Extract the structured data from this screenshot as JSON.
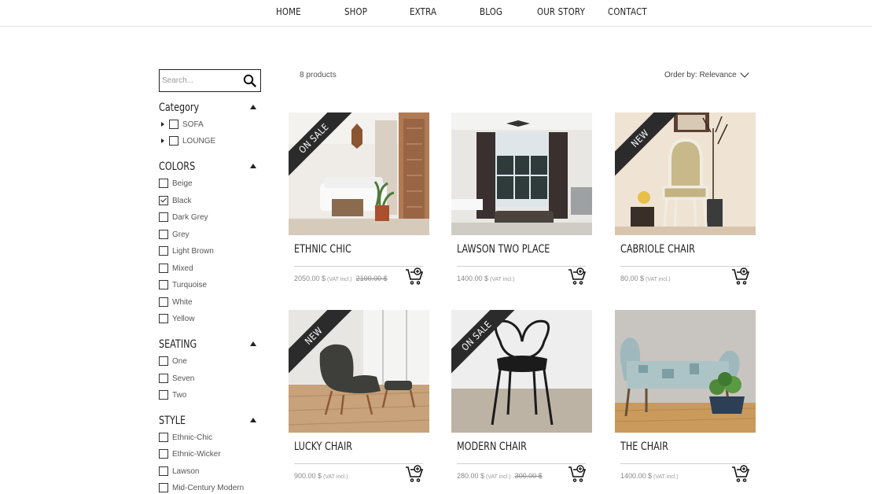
{
  "nav": {
    "items": [
      {
        "label": "HOME"
      },
      {
        "label": "SHOP"
      },
      {
        "label": "EXTRA"
      },
      {
        "label": "BLOG"
      },
      {
        "label": "OUR STORY"
      },
      {
        "label": "CONTACT"
      }
    ]
  },
  "search": {
    "placeholder": "Search...",
    "value": "",
    "icon": "search-icon"
  },
  "filters": {
    "category": {
      "title": "Category",
      "options": [
        {
          "label": "SOFA",
          "checked": false,
          "expandable": true
        },
        {
          "label": "LOUNGE",
          "checked": false,
          "expandable": true
        }
      ]
    },
    "colors": {
      "title": "COLORS",
      "options": [
        {
          "label": "Beige",
          "checked": false
        },
        {
          "label": "Black",
          "checked": true
        },
        {
          "label": "Dark Grey",
          "checked": false
        },
        {
          "label": "Grey",
          "checked": false
        },
        {
          "label": "Light Brown",
          "checked": false
        },
        {
          "label": "Mixed",
          "checked": false
        },
        {
          "label": "Turquoise",
          "checked": false
        },
        {
          "label": "White",
          "checked": false
        },
        {
          "label": "Yellow",
          "checked": false
        }
      ]
    },
    "seating": {
      "title": "SEATING",
      "options": [
        {
          "label": "One",
          "checked": false
        },
        {
          "label": "Seven",
          "checked": false
        },
        {
          "label": "Two",
          "checked": false
        }
      ]
    },
    "style": {
      "title": "STYLE",
      "options": [
        {
          "label": "Ethnic-Chic",
          "checked": false
        },
        {
          "label": "Ethnic-Wicker",
          "checked": false
        },
        {
          "label": "Lawson",
          "checked": false
        },
        {
          "label": "Mid-Century Modern",
          "checked": false
        }
      ]
    }
  },
  "listing": {
    "count": "8 products",
    "order_label": "Order by: Relevance"
  },
  "products": [
    {
      "name": "ETHNIC CHIC",
      "price": "2050.00 $",
      "vat": "(VAT incl.)",
      "old_price": "2100.00 $",
      "badge": "ON SALE"
    },
    {
      "name": "LAWSON TWO PLACE",
      "price": "1400.00 $",
      "vat": "(VAT incl.)",
      "old_price": "",
      "badge": ""
    },
    {
      "name": "CABRIOLE CHAIR",
      "price": "80.00 $",
      "vat": "(VAT incl.)",
      "old_price": "",
      "badge": "NEW"
    },
    {
      "name": "LUCKY CHAIR",
      "price": "900.00 $",
      "vat": "(VAT incl.)",
      "old_price": "",
      "badge": "NEW"
    },
    {
      "name": "MODERN CHAIR",
      "price": "280.00 $",
      "vat": "(VAT incl.)",
      "old_price": "300.00 $",
      "badge": "ON SALE"
    },
    {
      "name": "THE CHAIR",
      "price": "1400.00 $",
      "vat": "(VAT incl.)",
      "old_price": "",
      "badge": ""
    }
  ],
  "colors": {
    "text": "#222222",
    "muted": "#888888",
    "ribbon": "#2b2b2b",
    "divider": "#d0d0d0"
  }
}
